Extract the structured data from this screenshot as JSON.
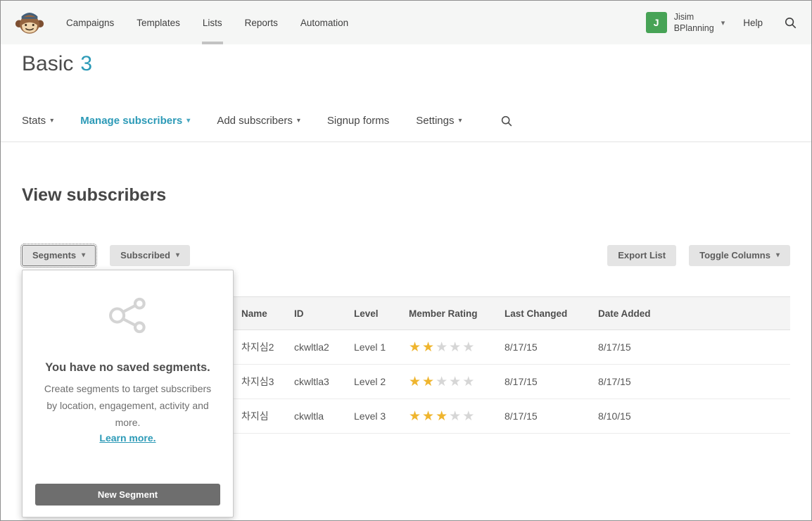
{
  "topnav": {
    "items": [
      {
        "label": "Campaigns",
        "active": false
      },
      {
        "label": "Templates",
        "active": false
      },
      {
        "label": "Lists",
        "active": true
      },
      {
        "label": "Reports",
        "active": false
      },
      {
        "label": "Automation",
        "active": false
      }
    ],
    "user": {
      "initial": "J",
      "name": "Jisim",
      "org": "BPlanning"
    },
    "help_label": "Help"
  },
  "page": {
    "title": "Basic",
    "count": "3"
  },
  "subnav": {
    "items": [
      {
        "label": "Stats",
        "dropdown": true,
        "active": false
      },
      {
        "label": "Manage subscribers",
        "dropdown": true,
        "active": true
      },
      {
        "label": "Add subscribers",
        "dropdown": true,
        "active": false
      },
      {
        "label": "Signup forms",
        "dropdown": false,
        "active": false
      },
      {
        "label": "Settings",
        "dropdown": true,
        "active": false
      }
    ]
  },
  "section": {
    "title": "View subscribers"
  },
  "toolbar": {
    "segments_label": "Segments",
    "status_filter_label": "Subscribed",
    "export_label": "Export List",
    "toggle_columns_label": "Toggle Columns"
  },
  "segments_popup": {
    "title": "You have no saved segments.",
    "body": "Create segments to target subscribers by location, engagement, activity and more.",
    "link": "Learn more.",
    "button": "New Segment"
  },
  "table": {
    "headers": [
      "Name",
      "ID",
      "Level",
      "Member Rating",
      "Last Changed",
      "Date Added"
    ],
    "rows": [
      {
        "name": "차지심2",
        "id": "ckwltla2",
        "level": "Level 1",
        "rating": 2,
        "last_changed": "8/17/15",
        "date_added": "8/17/15"
      },
      {
        "name": "차지심3",
        "id": "ckwltla3",
        "level": "Level 2",
        "rating": 2,
        "last_changed": "8/17/15",
        "date_added": "8/17/15"
      },
      {
        "name": "차지심",
        "id": "ckwltla",
        "level": "Level 3",
        "rating": 3,
        "last_changed": "8/17/15",
        "date_added": "8/10/15"
      }
    ]
  },
  "colors": {
    "accent": "#2c9ab7",
    "star_filled": "#efb52e",
    "star_empty": "#d6d6d6",
    "avatar_bg": "#47a356",
    "button_dark": "#6e6e6e"
  }
}
